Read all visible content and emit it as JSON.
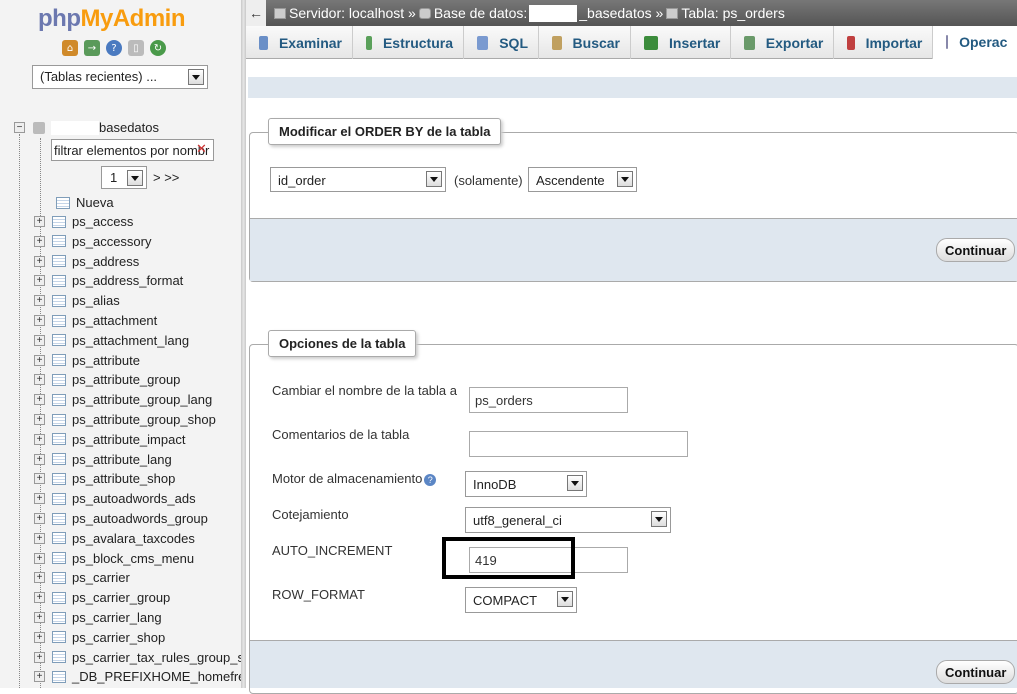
{
  "nav": {
    "logo_php": "php",
    "logo_myadmin": "MyAdmin",
    "recent_tables": "(Tablas recientes) ...",
    "db_name_suffix": "basedatos",
    "filter_placeholder": "filtrar elementos por nombr",
    "page_value": "1",
    "page_next": "> >>",
    "new_label": "Nueva",
    "tables": [
      "ps_access",
      "ps_accessory",
      "ps_address",
      "ps_address_format",
      "ps_alias",
      "ps_attachment",
      "ps_attachment_lang",
      "ps_attribute",
      "ps_attribute_group",
      "ps_attribute_group_lang",
      "ps_attribute_group_shop",
      "ps_attribute_impact",
      "ps_attribute_lang",
      "ps_attribute_shop",
      "ps_autoadwords_ads",
      "ps_autoadwords_group",
      "ps_avalara_taxcodes",
      "ps_block_cms_menu",
      "ps_carrier",
      "ps_carrier_group",
      "ps_carrier_lang",
      "ps_carrier_shop",
      "ps_carrier_tax_rules_group_s",
      "_DB_PREFIXHOME_homefre"
    ]
  },
  "breadcrumb": {
    "server": "Servidor: localhost »",
    "db_prefix": "Base de datos:",
    "db_suffix": "_basedatos »",
    "table": "Tabla: ps_orders"
  },
  "tabs": [
    {
      "label": "Examinar",
      "color": "#6a8fc7"
    },
    {
      "label": "Estructura",
      "color": "#5aa05a"
    },
    {
      "label": "SQL",
      "color": "#7a9ad0"
    },
    {
      "label": "Buscar",
      "color": "#c0a060"
    },
    {
      "label": "Insertar",
      "color": "#3c8c3c"
    },
    {
      "label": "Exportar",
      "color": "#6a9a6a"
    },
    {
      "label": "Importar",
      "color": "#c04040"
    },
    {
      "label": "Operac",
      "color": "#8888aa"
    }
  ],
  "orderby": {
    "legend": "Modificar el ORDER BY de la tabla",
    "column": "id_order",
    "only": "(solamente)",
    "direction": "Ascendente",
    "submit": "Continuar"
  },
  "options": {
    "legend": "Opciones de la tabla",
    "rename_label": "Cambiar el nombre de la tabla a",
    "rename_value": "ps_orders",
    "comments_label": "Comentarios de la tabla",
    "comments_value": "",
    "engine_label": "Motor de almacenamiento",
    "engine_value": "InnoDB",
    "collation_label": "Cotejamiento",
    "collation_value": "utf8_general_ci",
    "autoinc_label": "AUTO_INCREMENT",
    "autoinc_value": "419",
    "rowformat_label": "ROW_FORMAT",
    "rowformat_value": "COMPACT",
    "submit": "Continuar"
  }
}
